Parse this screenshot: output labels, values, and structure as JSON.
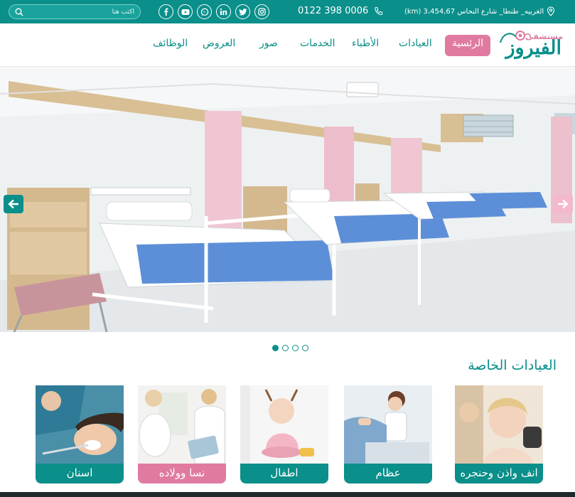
{
  "topbar": {
    "search_placeholder": "اكتب هنا",
    "phone": "0122 398 0006",
    "address": "الغربيه_ طنطا_ شارع النحاس 3،454,67 (km)",
    "socials": [
      "instagram-icon",
      "twitter-icon",
      "linkedin-icon",
      "whatsapp-icon",
      "youtube-icon",
      "facebook-icon"
    ],
    "color": "#0a8f8a"
  },
  "logo": {
    "sub": "مستشفى",
    "main": "الفيروز"
  },
  "nav": {
    "items": [
      {
        "label": "الرئسية",
        "active": true
      },
      {
        "label": "العيادات",
        "active": false
      },
      {
        "label": "الأطباء",
        "active": false
      },
      {
        "label": "الخدمات",
        "active": false
      },
      {
        "label": "صور",
        "active": false
      },
      {
        "label": "العروض",
        "active": false
      },
      {
        "label": "الوظائف",
        "active": false
      }
    ],
    "active_color": "#e07aa0"
  },
  "slider": {
    "slides": 4,
    "active_slide": 1
  },
  "clinics": {
    "title": "العيادات الخاصة",
    "cards": [
      {
        "label": "انف واذن وحنجره"
      },
      {
        "label": "عظام"
      },
      {
        "label": "اطفال"
      },
      {
        "label": "نسا وولاده"
      },
      {
        "label": "اسنان"
      }
    ]
  }
}
